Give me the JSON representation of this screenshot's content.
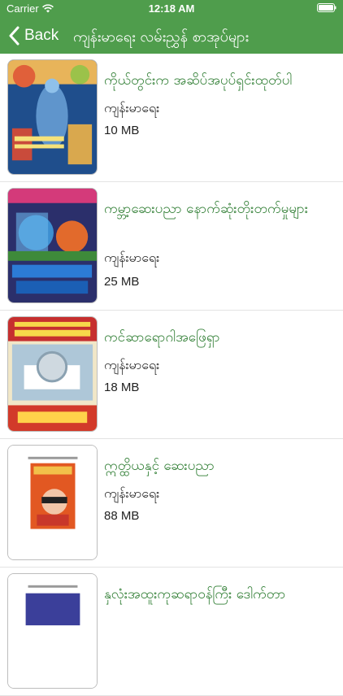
{
  "status_bar": {
    "carrier": "Carrier",
    "time": "12:18 AM"
  },
  "nav": {
    "back_label": "Back",
    "title": "ကျန်းမာရေး လမ်းညွှန် စာအုပ်များ"
  },
  "books": [
    {
      "title": "ကိုယ်တွင်းက အဆိပ်အပုပ်ရှင်းထုတ်ပါ",
      "category": "ကျန်းမာရေး",
      "size": "10 MB"
    },
    {
      "title": "ကမ္ဘာ့ဆေးပညာ နောက်ဆုံးတိုးတက်မှုများ",
      "category": "ကျန်းမာရေး",
      "size": "25 MB"
    },
    {
      "title": "ကင်ဆာရောဂါအဖြေရှာ",
      "category": "ကျန်းမာရေး",
      "size": "18 MB"
    },
    {
      "title": "ဣတ္ထိယနှင့် ဆေးပညာ",
      "category": "ကျန်းမာရေး",
      "size": "88 MB"
    },
    {
      "title": "နှလုံးအထူးကုဆရာဝန်ကြီး ဒေါက်တာ",
      "category": "",
      "size": ""
    }
  ]
}
